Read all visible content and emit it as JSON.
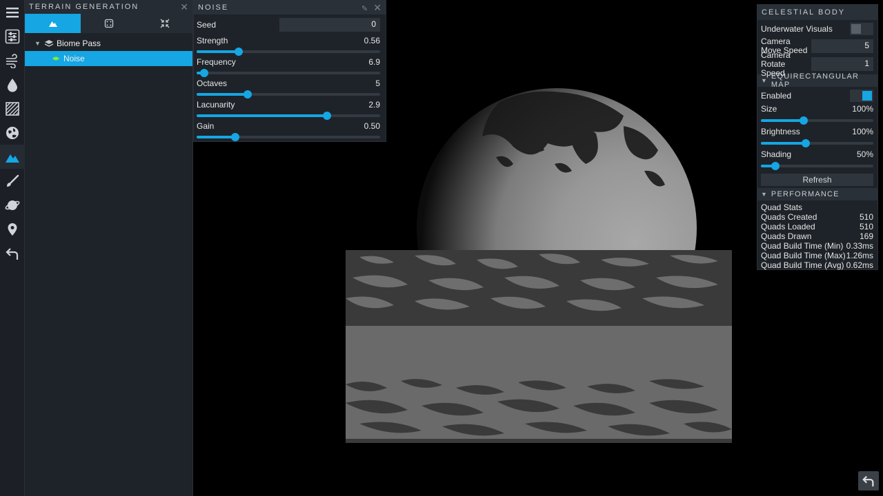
{
  "rail": {
    "items": [
      {
        "icon": "menu-icon"
      },
      {
        "icon": "sliders-icon"
      },
      {
        "icon": "wind-icon"
      },
      {
        "icon": "water-drop-icon"
      },
      {
        "icon": "hatch-icon"
      },
      {
        "icon": "globe-icon"
      },
      {
        "icon": "mountain-icon",
        "active": true
      },
      {
        "icon": "brush-icon"
      },
      {
        "icon": "planet-icon"
      },
      {
        "icon": "location-pin-icon"
      },
      {
        "icon": "undo-icon"
      }
    ]
  },
  "terrain_generation": {
    "title": "TERRAIN GENERATION",
    "tabs": [
      {
        "icon": "mountain-icon",
        "active": true
      },
      {
        "icon": "dice-icon"
      },
      {
        "icon": "collapse-icon"
      }
    ],
    "tree": {
      "root_label": "Biome Pass",
      "child_label": "Noise"
    }
  },
  "noise": {
    "title": "NOISE",
    "seed_label": "Seed",
    "seed_value": "0",
    "params": [
      {
        "label": "Strength",
        "value": "0.56",
        "fraction": 0.23
      },
      {
        "label": "Frequency",
        "value": "6.9",
        "fraction": 0.04
      },
      {
        "label": "Octaves",
        "value": "5",
        "fraction": 0.28
      },
      {
        "label": "Lacunarity",
        "value": "2.9",
        "fraction": 0.71
      },
      {
        "label": "Gain",
        "value": "0.50",
        "fraction": 0.21
      }
    ]
  },
  "celestial_body": {
    "title": "CELESTIAL BODY",
    "underwater_visuals_label": "Underwater Visuals",
    "camera_move_label_1": "Camera",
    "camera_move_label_2": "Move Speed",
    "camera_move_value": "5",
    "camera_rotate_label_1": "Camera",
    "camera_rotate_label_2": "Rotate Speed",
    "camera_rotate_value": "1",
    "equirect": {
      "title": "EQUIRECTANGULAR MAP",
      "enabled_label": "Enabled",
      "sliders": [
        {
          "label": "Size",
          "value": "100%",
          "fraction": 0.38
        },
        {
          "label": "Brightness",
          "value": "100%",
          "fraction": 0.4
        },
        {
          "label": "Shading",
          "value": "50%",
          "fraction": 0.13
        }
      ],
      "refresh_label": "Refresh"
    },
    "performance": {
      "title": "PERFORMANCE",
      "stats_label": "Quad Stats",
      "stats": [
        {
          "label": "Quads Created",
          "value": "510"
        },
        {
          "label": "Quads Loaded",
          "value": "510"
        },
        {
          "label": "Quads Drawn",
          "value": "169"
        },
        {
          "label": "Quad Build Time (Min)",
          "value": "0.33ms"
        },
        {
          "label": "Quad Build Time (Max)",
          "value": "1.26ms"
        },
        {
          "label": "Quad Build Time (Avg)",
          "value": "0.62ms"
        }
      ]
    }
  },
  "colors": {
    "accent": "#15a6e3",
    "panel": "#1e2329",
    "background": "#000000"
  }
}
